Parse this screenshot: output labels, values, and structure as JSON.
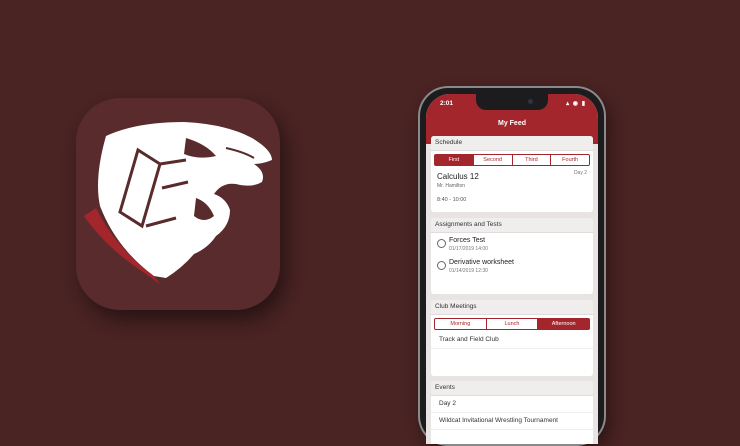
{
  "app": {
    "name": "My Feed"
  },
  "status": {
    "time": "2:01",
    "icons": "▴ ◉ ▮"
  },
  "schedule": {
    "title": "Schedule",
    "tabs": [
      "First",
      "Second",
      "Third",
      "Fourth"
    ],
    "active_tab": 0,
    "course": "Calculus 12",
    "teacher": "Mr. Hamilton",
    "day": "Day 2",
    "times": "8:40 - 10:00"
  },
  "assignments": {
    "title": "Assignments and Tests",
    "items": [
      {
        "title": "Forces Test",
        "date": "01/17/2019 14:00"
      },
      {
        "title": "Derivative worksheet",
        "date": "01/14/2019 12:30"
      }
    ]
  },
  "clubs": {
    "title": "Club Meetings",
    "tabs": [
      "Morning",
      "Lunch",
      "Afternoon"
    ],
    "active_tab": 2,
    "items": [
      "Track and Field Club"
    ]
  },
  "events": {
    "title": "Events",
    "items": [
      "Day 2",
      "Wildcat Invitational Wrestling Tournament"
    ]
  },
  "colors": {
    "background": "#4a2323",
    "accent": "#a3262d",
    "icon_bg": "#5a2b2c"
  },
  "icons": {
    "logo": "wildcat-logo-icon"
  }
}
